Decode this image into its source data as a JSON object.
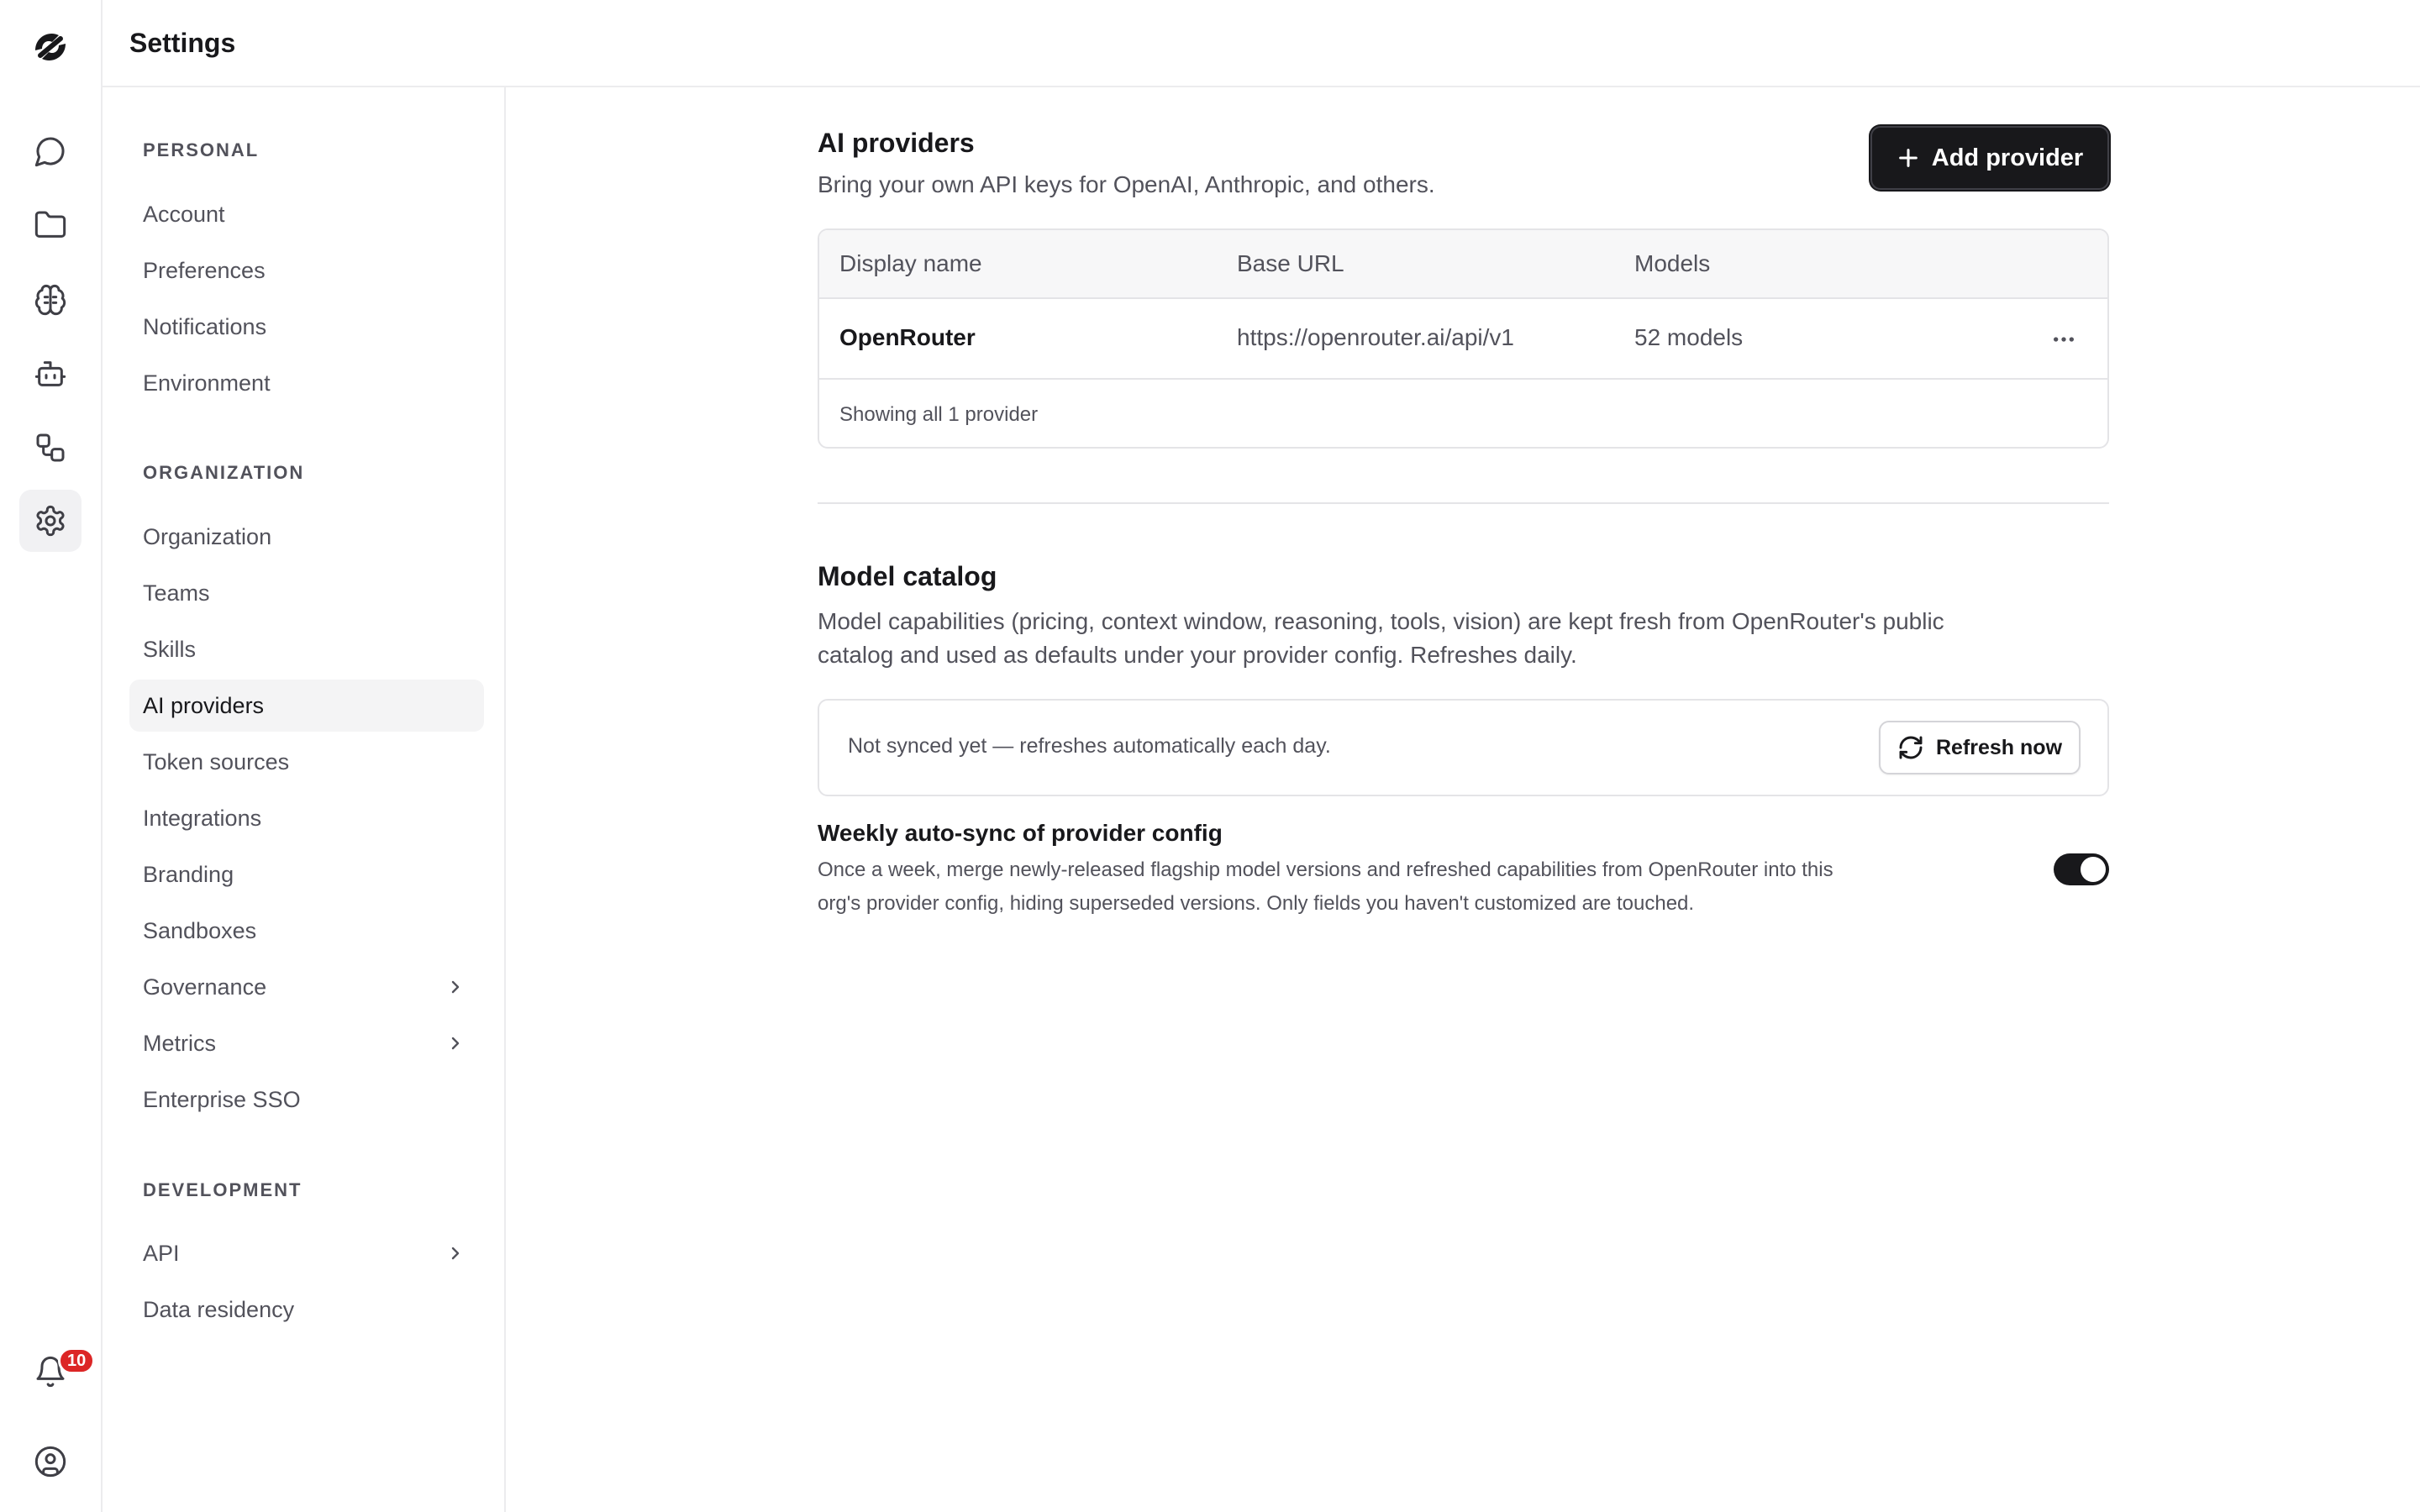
{
  "header": {
    "title": "Settings"
  },
  "rail": {
    "icons": [
      "brand-logo",
      "chat-icon",
      "folder-icon",
      "brain-icon",
      "bot-icon",
      "workflow-icon",
      "gear-icon",
      "bell-icon",
      "user-circle-icon"
    ],
    "notification_count": "10"
  },
  "sidebar": {
    "personal": {
      "title": "PERSONAL",
      "items": [
        "Account",
        "Preferences",
        "Notifications",
        "Environment"
      ]
    },
    "organization": {
      "title": "ORGANIZATION",
      "items": [
        "Organization",
        "Teams",
        "Skills",
        "AI providers",
        "Token sources",
        "Integrations",
        "Branding",
        "Sandboxes",
        "Governance",
        "Metrics",
        "Enterprise SSO"
      ]
    },
    "development": {
      "title": "DEVELOPMENT",
      "items": [
        "API",
        "Data residency"
      ]
    },
    "active_item": "AI providers"
  },
  "providers": {
    "title": "AI providers",
    "subtitle": "Bring your own API keys for OpenAI, Anthropic, and others.",
    "add_button": "Add provider",
    "columns": [
      "Display name",
      "Base URL",
      "Models"
    ],
    "rows": [
      {
        "name": "OpenRouter",
        "base_url": "https://openrouter.ai/api/v1",
        "models": "52 models"
      }
    ],
    "footer": "Showing all 1 provider"
  },
  "catalog": {
    "title": "Model catalog",
    "description_line1": "Model capabilities (pricing, context window, reasoning, tools, vision) are kept fresh from OpenRouter's public",
    "description_line2": "catalog and used as defaults under your provider config. Refreshes daily.",
    "sync_status": "Not synced yet — refreshes automatically each day.",
    "refresh_button": "Refresh now"
  },
  "auto_sync": {
    "title": "Weekly auto-sync of provider config",
    "description_line1": "Once a week, merge newly-released flagship model versions and refreshed capabilities from OpenRouter into this",
    "description_line2": "org's provider config, hiding superseded versions. Only fields you haven't customized are touched.",
    "enabled": true
  },
  "colors": {
    "accent": "#18181b",
    "badge": "#dc2626",
    "border": "#e4e4e7",
    "muted_text": "#52525b"
  }
}
